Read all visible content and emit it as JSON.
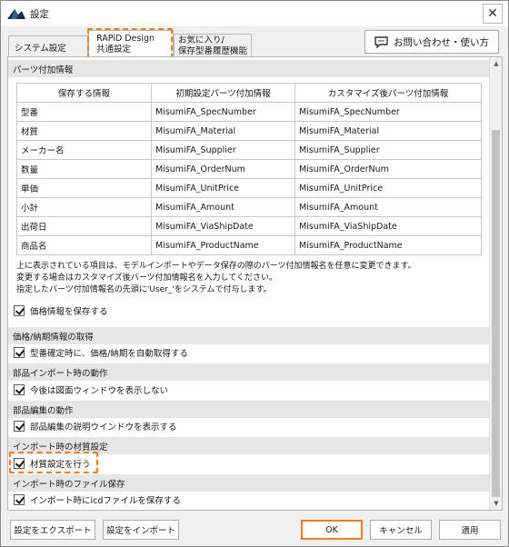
{
  "window": {
    "title": "設定",
    "close_glyph": "✕"
  },
  "tabs": [
    {
      "line1": "システム設定",
      "line2": ""
    },
    {
      "line1": "RAPiD Design",
      "line2": "共通設定"
    },
    {
      "line1": "お気に入り/",
      "line2": "保存型番履歴機能"
    }
  ],
  "inquiry_button": {
    "label": "お問い合わせ・使い方",
    "icon": "chat-bubble-icon"
  },
  "sections": {
    "parts_info": "パーツ付加情報",
    "price": "価格/納期情報の取得",
    "import_behavior": "部品インポート時の動作",
    "edit_behavior": "部品編集の動作",
    "material": "インポート時の材質設定",
    "file_save": "インポート時のファイル保存"
  },
  "parts_table": {
    "headers": [
      "保存する情報",
      "初期設定パーツ付加情報",
      "カスタマイズ後パーツ付加情報"
    ],
    "rows": [
      [
        "型番",
        "MisumiFA_SpecNumber",
        "MisumiFA_SpecNumber"
      ],
      [
        "材質",
        "MisumiFA_Material",
        "MisumiFA_Material"
      ],
      [
        "メーカー名",
        "MisumiFA_Supplier",
        "MisumiFA_Supplier"
      ],
      [
        "数量",
        "MisumiFA_OrderNum",
        "MisumiFA_OrderNum"
      ],
      [
        "単価",
        "MisumiFA_UnitPrice",
        "MisumiFA_UnitPrice"
      ],
      [
        "小計",
        "MisumiFA_Amount",
        "MisumiFA_Amount"
      ],
      [
        "出荷日",
        "MisumiFA_ViaShipDate",
        "MisumiFA_ViaShipDate"
      ],
      [
        "商品名",
        "MisumiFA_ProductName",
        "MisumiFA_ProductName"
      ]
    ]
  },
  "notes": [
    "上に表示されている項目は、モデルインポートやデータ保存の際のパーツ付加情報名を任意に変更できます。",
    "変更する場合はカスタマイズ後パーツ付加情報名を入力してください。",
    "指定したパーツ付加情報名の先頭に'User_'をシステムで付与します。"
  ],
  "checkboxes": {
    "save_price": {
      "label": "価格情報を保存する",
      "checked": true
    },
    "auto_price": {
      "label": "型番確定時に、価格/納期を自動取得する",
      "checked": true
    },
    "no_drawing": {
      "label": "今後は図面ウィンドウを表示しない",
      "checked": true
    },
    "edit_desc": {
      "label": "部品編集の説明ウインドウを表示する",
      "checked": true
    },
    "material_set": {
      "label": "材質設定を行う",
      "checked": true
    },
    "save_icd": {
      "label": "インポート時にicdファイルを保存する",
      "checked": true
    }
  },
  "footer": {
    "export": "設定をエクスポート",
    "import": "設定をインポート",
    "ok": "OK",
    "cancel": "キャンセル",
    "apply": "適用"
  },
  "colors": {
    "highlight": "#f07c1a",
    "section_bg": "#e6e6e6"
  }
}
